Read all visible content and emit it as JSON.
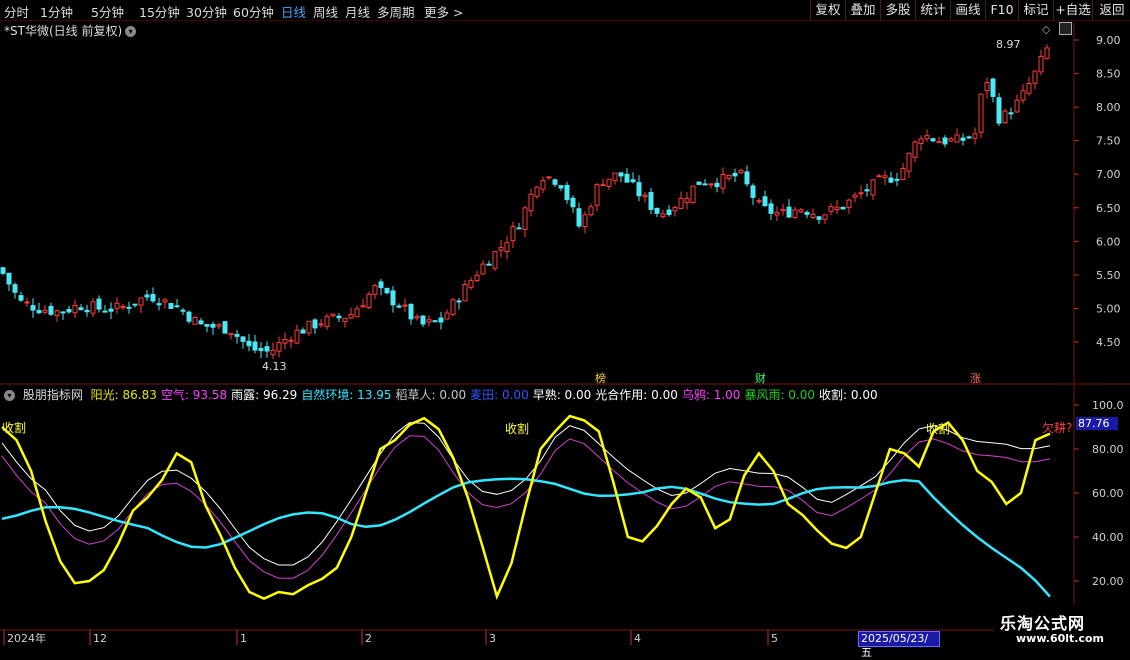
{
  "toolbar": {
    "periods": [
      "分时",
      "1分钟",
      "5分钟",
      "15分钟",
      "30分钟",
      "60分钟",
      "日线",
      "周线",
      "月线",
      "多周期",
      "更多"
    ],
    "active_period": "日线",
    "buttons": [
      "复权",
      "叠加",
      "多股",
      "统计",
      "画线",
      "F10",
      "+自选",
      "返回"
    ]
  },
  "stock": {
    "title": "*ST华微(日线 前复权)",
    "high_label": "8.97",
    "low_label": "4.13",
    "price_axis": [
      "9.00",
      "8.50",
      "8.00",
      "7.50",
      "7.00",
      "6.50",
      "6.00",
      "5.50",
      "5.00",
      "4.50"
    ],
    "event_markers": [
      "榜",
      "财",
      "涨"
    ]
  },
  "indicator": {
    "name": "股朋指标网",
    "items": [
      {
        "label": "阳光:",
        "value": "86.83",
        "color": "#e6e600"
      },
      {
        "label": "空气:",
        "value": "93.58",
        "color": "#ff3cff"
      },
      {
        "label": "雨露:",
        "value": "96.29",
        "color": "#ffffff"
      },
      {
        "label": "自然环境:",
        "value": "13.95",
        "color": "#33e6ff"
      },
      {
        "label": "稻草人:",
        "value": "0.00",
        "color": "#c8c8c8"
      },
      {
        "label": "麦田:",
        "value": "0.00",
        "color": "#3355ff"
      },
      {
        "label": "早熟:",
        "value": "0.00",
        "color": "#ffffff"
      },
      {
        "label": "光合作用:",
        "value": "0.00",
        "color": "#ffffff"
      },
      {
        "label": "乌鸦:",
        "value": "1.00",
        "color": "#ff3cff"
      },
      {
        "label": "暴风雨:",
        "value": "0.00",
        "color": "#22cc22"
      },
      {
        "label": "收割:",
        "value": "0.00",
        "color": "#ffffff"
      }
    ],
    "axis": [
      "100.0",
      "80.00",
      "60.00",
      "40.00",
      "20.00"
    ],
    "current_value": "87.76",
    "harvest_label": "收割",
    "warning_label": "欠耕?"
  },
  "time_axis": {
    "labels": [
      "2024年",
      "12",
      "1",
      "2",
      "3",
      "4",
      "5"
    ],
    "selected_date": "2025/05/23/五"
  },
  "watermark": {
    "title": "乐淘公式网",
    "url": "www.60lt.com"
  },
  "colors": {
    "up": "#ff3b3b",
    "down": "#4de8f5",
    "grid": "#7a1010"
  },
  "chart_data": {
    "type": "line",
    "series": [
      {
        "name": "阳光",
        "values": [
          90,
          84,
          70,
          47,
          29,
          19,
          20,
          25,
          37,
          52,
          58,
          66,
          78,
          74,
          54,
          41,
          26,
          15,
          12,
          15,
          14,
          18,
          21,
          26,
          40,
          60,
          80,
          84,
          91,
          94,
          89,
          76,
          58,
          36,
          13,
          28,
          55,
          80,
          88,
          95,
          93,
          88,
          65,
          40,
          38,
          45,
          55,
          62,
          58,
          44,
          48,
          68,
          78,
          70,
          55,
          50,
          43,
          37,
          35,
          40,
          60,
          80,
          78,
          72,
          88,
          92,
          84,
          70,
          65,
          55,
          60,
          84,
          87
        ]
      }
    ]
  }
}
